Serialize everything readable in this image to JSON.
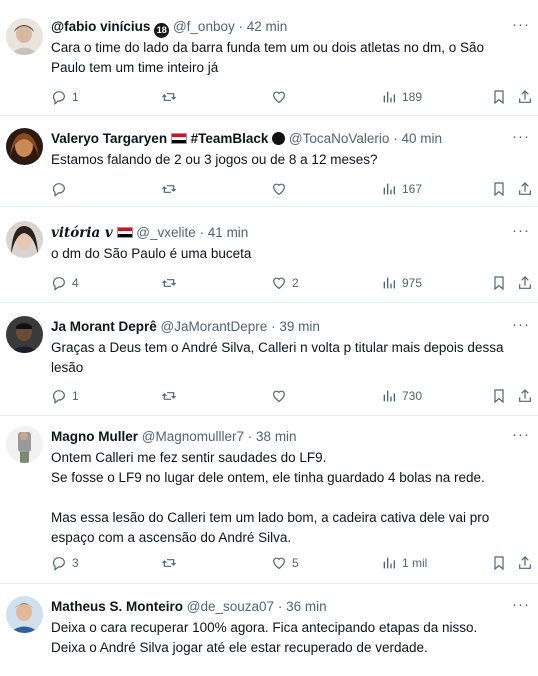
{
  "tweets": [
    {
      "name": "@fabio vinícius",
      "handle": "@f_onboy",
      "time": "42 min",
      "text": "Cara o time do lado da barra funda tem um ou dois atletas no dm, o São\nPaulo tem um time inteiro já",
      "badge": "18",
      "replies": "1",
      "retweets": "",
      "likes": "",
      "views": "189"
    },
    {
      "name": "Valeryo Targaryen",
      "name_suffix": "#TeamBlack",
      "handle": "@TocaNoValerio",
      "time": "40 min",
      "text": "Estamos falando de 2 ou 3 jogos ou de 8 a 12 meses?",
      "replies": "",
      "retweets": "",
      "likes": "",
      "views": "167"
    },
    {
      "name": "vitória v",
      "handle": "@_vxelite",
      "time": "41 min",
      "text": "o dm do São Paulo é uma buceta",
      "replies": "4",
      "retweets": "",
      "likes": "2",
      "views": "975"
    },
    {
      "name": "Ja Morant Deprê",
      "handle": "@JaMorantDepre",
      "time": "39 min",
      "text": "Graças a Deus tem o André Silva, Calleri n volta p titular mais depois dessa\nlesão",
      "replies": "1",
      "retweets": "",
      "likes": "",
      "views": "730"
    },
    {
      "name": "Magno Muller",
      "handle": "@Magnomulller7",
      "time": "38 min",
      "text": "Ontem Calleri me fez sentir saudades do LF9.\nSe fosse o LF9 no lugar dele ontem, ele tinha guardado 4 bolas na rede.\n\nMas essa lesão do Calleri tem um lado bom, a cadeira cativa dele vai pro\nespaço com a ascensão do André Silva.",
      "replies": "3",
      "retweets": "",
      "likes": "5",
      "views": "1 mil"
    },
    {
      "name": "Matheus S. Monteiro",
      "handle": "@de_souza07",
      "time": "36 min",
      "text": "Deixa o cara recuperar 100% agora. Fica antecipando etapas da nisso.\nDeixa o André Silva jogar até ele estar recuperado de verdade."
    }
  ],
  "colors": {
    "text": "#0f1419",
    "muted": "#536471",
    "divider": "#e6ecf0"
  },
  "icons": [
    "reply-icon",
    "retweet-icon",
    "like-icon",
    "views-icon",
    "bookmark-icon",
    "share-icon",
    "more-icon"
  ]
}
